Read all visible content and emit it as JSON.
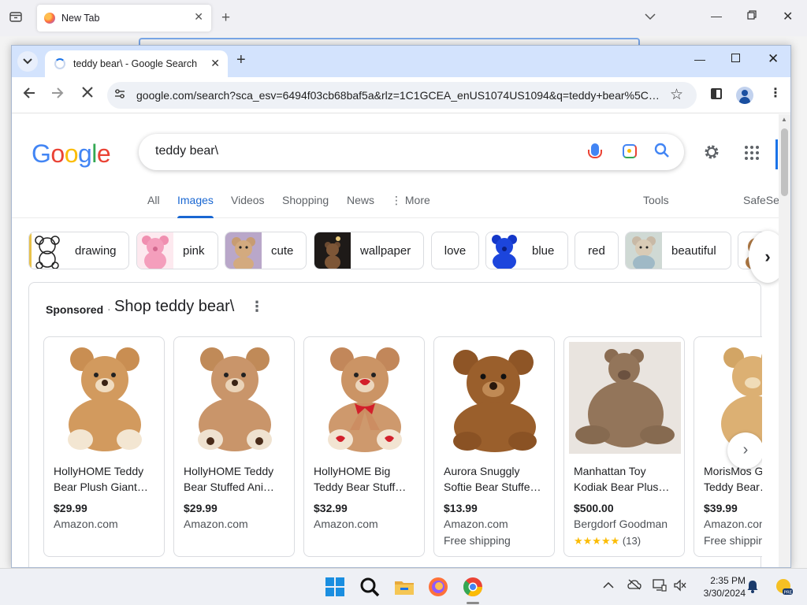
{
  "firefox": {
    "tab_title": "New Tab"
  },
  "chrome": {
    "tab_title": "teddy bear\\ - Google Search",
    "url": "google.com/search?sca_esv=6494f03cb68baf5a&rlz=1C1GCEA_enUS1074US1094&q=teddy+bear%5C&tb..."
  },
  "google": {
    "logo": [
      "G",
      "o",
      "o",
      "g",
      "l",
      "e"
    ],
    "query": "teddy bear\\",
    "nav_tabs": [
      {
        "label": "All"
      },
      {
        "label": "Images"
      },
      {
        "label": "Videos"
      },
      {
        "label": "Shopping"
      },
      {
        "label": "News"
      },
      {
        "label": "⋮ More"
      }
    ],
    "tools_label": "Tools",
    "safesearch_label": "SafeSe",
    "chips": [
      {
        "label": "drawing"
      },
      {
        "label": "pink"
      },
      {
        "label": "cute"
      },
      {
        "label": "wallpaper"
      },
      {
        "label": "love"
      },
      {
        "label": "blue"
      },
      {
        "label": "red"
      },
      {
        "label": "beautiful"
      }
    ],
    "sponsored": {
      "label": "Sponsored",
      "separator": "·",
      "title": "Shop teddy bear\\",
      "products": [
        {
          "name": "HollyHOME Teddy Bear Plush Giant…",
          "price": "$29.99",
          "store": "Amazon.com"
        },
        {
          "name": "HollyHOME Teddy Bear Stuffed Ani…",
          "price": "$29.99",
          "store": "Amazon.com"
        },
        {
          "name": "HollyHOME Big Teddy Bear Stuff…",
          "price": "$32.99",
          "store": "Amazon.com"
        },
        {
          "name": "Aurora Snuggly Softie Bear Stuffe…",
          "price": "$13.99",
          "store": "Amazon.com",
          "shipping": "Free shipping"
        },
        {
          "name": "Manhattan Toy Kodiak Bear Plus…",
          "price": "$500.00",
          "store": "Bergdorf Goodman",
          "stars": "★★★★★",
          "reviews": "(13)"
        },
        {
          "name": "MorisMos Giant Teddy Bear…",
          "price": "$39.99",
          "store": "Amazon.com",
          "shipping": "Free shipping"
        }
      ]
    }
  },
  "taskbar": {
    "time": "2:35 PM",
    "date": "3/30/2024"
  },
  "colors": {
    "accent_blue": "#1967d2",
    "chrome_tabstrip": "#d3e3fd",
    "star_yellow": "#fbbc05"
  }
}
